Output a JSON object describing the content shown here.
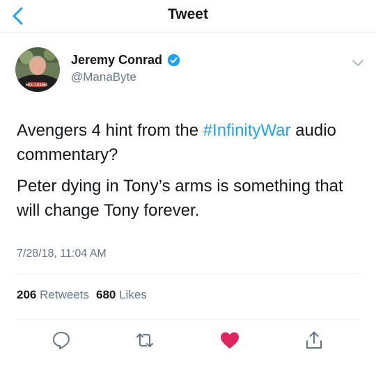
{
  "nav": {
    "title": "Tweet"
  },
  "author": {
    "name": "Jeremy Conrad",
    "handle": "@ManaByte",
    "avatar_badge": "MCU COSMIC"
  },
  "tweet": {
    "line1_before": "Avengers 4 hint from the ",
    "hashtag": "#InfinityWar",
    "line1_after": " audio commentary?",
    "paragraph2": "Peter dying in Tony’s arms is something that will change Tony forever.",
    "timestamp": "7/28/18, 11:04 AM"
  },
  "stats": {
    "retweets_count": "206",
    "retweets_label": "Retweets",
    "likes_count": "680",
    "likes_label": "Likes"
  },
  "colors": {
    "accent": "#1da1f2",
    "like": "#e0245e",
    "muted": "#657786",
    "divider": "#e6ecf0"
  },
  "icons": [
    "back-chevron-icon",
    "verified-icon",
    "chevron-down-icon",
    "reply-icon",
    "retweet-icon",
    "heart-icon",
    "share-icon"
  ]
}
